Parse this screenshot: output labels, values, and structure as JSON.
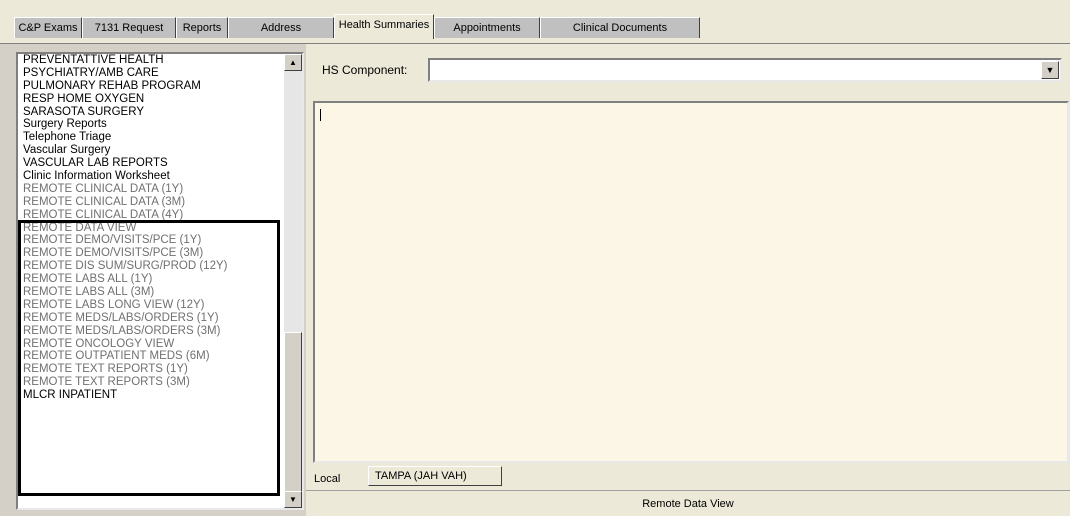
{
  "tabs": [
    {
      "label": "C&P Exams",
      "active": false
    },
    {
      "label": "7131 Request",
      "active": false
    },
    {
      "label": "Reports",
      "active": false
    },
    {
      "label": "Address",
      "active": false
    },
    {
      "label": "Health Summaries",
      "active": true
    },
    {
      "label": "Appointments",
      "active": false
    },
    {
      "label": "Clinical Documents",
      "active": false
    }
  ],
  "list": {
    "items": [
      {
        "label": "PREVENTATTIVE HEALTH",
        "remote": false
      },
      {
        "label": "PSYCHIATRY/AMB CARE",
        "remote": false
      },
      {
        "label": "PULMONARY REHAB PROGRAM",
        "remote": false
      },
      {
        "label": "RESP HOME OXYGEN",
        "remote": false
      },
      {
        "label": "SARASOTA SURGERY",
        "remote": false
      },
      {
        "label": "Surgery Reports",
        "remote": false
      },
      {
        "label": "Telephone Triage",
        "remote": false
      },
      {
        "label": "Vascular Surgery",
        "remote": false
      },
      {
        "label": "VASCULAR LAB REPORTS",
        "remote": false
      },
      {
        "label": "Clinic Information Worksheet",
        "remote": false
      },
      {
        "label": "REMOTE CLINICAL DATA (1Y)",
        "remote": true
      },
      {
        "label": "REMOTE CLINICAL DATA (3M)",
        "remote": true
      },
      {
        "label": "REMOTE CLINICAL DATA (4Y)",
        "remote": true
      },
      {
        "label": "REMOTE DATA VIEW",
        "remote": true
      },
      {
        "label": "REMOTE DEMO/VISITS/PCE (1Y)",
        "remote": true
      },
      {
        "label": "REMOTE DEMO/VISITS/PCE (3M)",
        "remote": true
      },
      {
        "label": "REMOTE DIS SUM/SURG/PROD (12Y)",
        "remote": true
      },
      {
        "label": "REMOTE LABS ALL (1Y)",
        "remote": true
      },
      {
        "label": "REMOTE LABS ALL (3M)",
        "remote": true
      },
      {
        "label": "REMOTE LABS LONG VIEW (12Y)",
        "remote": true
      },
      {
        "label": "REMOTE MEDS/LABS/ORDERS (1Y)",
        "remote": true
      },
      {
        "label": "REMOTE MEDS/LABS/ORDERS (3M)",
        "remote": true
      },
      {
        "label": "REMOTE ONCOLOGY VIEW",
        "remote": true
      },
      {
        "label": "REMOTE OUTPATIENT MEDS (6M)",
        "remote": true
      },
      {
        "label": "REMOTE TEXT REPORTS (1Y)",
        "remote": true
      },
      {
        "label": "REMOTE TEXT REPORTS (3M)",
        "remote": true
      },
      {
        "label": "MLCR INPATIENT",
        "remote": false
      }
    ]
  },
  "right": {
    "hs_component_label": "HS Component:",
    "hs_component_value": "",
    "text": "",
    "bottom_tabs": {
      "local": "Local",
      "remote": "TAMPA (JAH VAH)"
    },
    "status": "Remote Data View"
  },
  "colors": {
    "remote_text": "#707070",
    "text_bg": "#fcf6e6",
    "chrome": "#ece9d8"
  },
  "icons": {
    "scroll_up": "▲",
    "scroll_down": "▼",
    "dropdown": "▼"
  }
}
